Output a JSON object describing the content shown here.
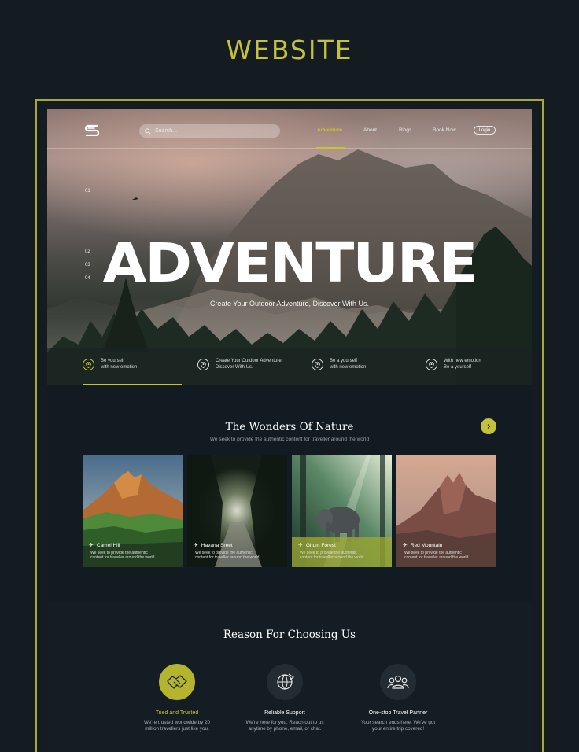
{
  "page_heading": "WEBSITE",
  "search": {
    "placeholder": "Search..."
  },
  "nav": {
    "items": [
      "Adventure",
      "About",
      "Blogs",
      "Book Now"
    ],
    "login": "Login"
  },
  "hero": {
    "title": "ADVENTURE",
    "subtitle": "Create Your Outdoor Adventure, Discover With Us.",
    "slides": [
      "01",
      "02",
      "03",
      "04"
    ]
  },
  "features": [
    {
      "line1": "Be yourself",
      "line2": "with new emotion"
    },
    {
      "line1": "Create Your Outdoor Adventure,",
      "line2": "Discover With Us."
    },
    {
      "line1": "Be a yourself",
      "line2": "with new emotion"
    },
    {
      "line1": "With new emotion",
      "line2": "Be a yourself"
    }
  ],
  "wonders": {
    "title": "The Wonders Of Nature",
    "subtitle": "We seek to provide the authentic content for  traveller around the world",
    "cards": [
      {
        "name": "Camel Hill",
        "desc1": "We seek to provide the authentic",
        "desc2": "content for  traveller around the world"
      },
      {
        "name": "Havana Sreet",
        "desc1": "We seek to provide the authentic",
        "desc2": "content for  traveller around the world"
      },
      {
        "name": "Ghum Forest",
        "desc1": "We seek to provide the authentic",
        "desc2": "content for  traveller around the world"
      },
      {
        "name": "Red Mountain",
        "desc1": "We seek to provide the authentic",
        "desc2": "content for  traveller around the world"
      }
    ]
  },
  "reasons": {
    "title": "Reason For Choosing Us",
    "items": [
      {
        "title": "Tried and Trusted",
        "desc1": "We're trusted worldwide by 20",
        "desc2": "million travellers just like you.",
        "icon": "handshake-icon"
      },
      {
        "title": "Reliable Support",
        "desc1": "We're here for you. Reach out to us",
        "desc2": "anytime by phone, email, or chat.",
        "icon": "support-globe-icon"
      },
      {
        "title": "One-stop Travel Partner",
        "desc1": "Your search ends here. We've got",
        "desc2": "your entire trip covered!",
        "icon": "group-icon"
      }
    ]
  },
  "colors": {
    "accent": "#c4c23a",
    "background": "#141b21",
    "panel": "#111a1f"
  }
}
